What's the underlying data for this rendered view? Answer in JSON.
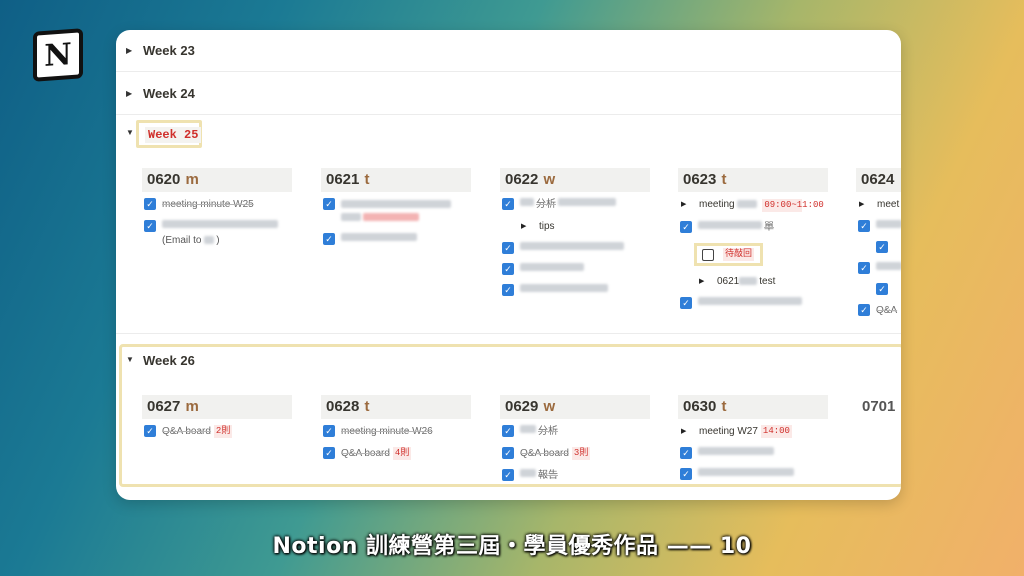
{
  "weeks": {
    "w23": "Week 23",
    "w24": "Week 24",
    "w25": "Week 25",
    "w26": "Week 26"
  },
  "week25_days": [
    {
      "date": "0620",
      "wd": "m"
    },
    {
      "date": "0621",
      "wd": "t"
    },
    {
      "date": "0622",
      "wd": "w"
    },
    {
      "date": "0623",
      "wd": "t"
    },
    {
      "date": "0624",
      "wd": ""
    }
  ],
  "week26_days": [
    {
      "date": "0627",
      "wd": "m"
    },
    {
      "date": "0628",
      "wd": "t"
    },
    {
      "date": "0629",
      "wd": "w"
    },
    {
      "date": "0630",
      "wd": "t"
    },
    {
      "date": "0701",
      "wd": ""
    }
  ],
  "items": {
    "d0620_1": "meeting minute W25",
    "d0620_note": "(Email to",
    "d0620_note_end": ")",
    "d0622_1": "分析",
    "d0622_tips": "tips",
    "d0623_meeting": "meeting",
    "d0623_time": "09:00~11:00",
    "d0623_2": "單",
    "d0623_pending": "待敲回",
    "d0623_test_prefix": "0621",
    "d0623_test": "test",
    "d0624_1": "meet",
    "d0624_qa": "Q&A",
    "d0627_1": "Q&A board",
    "d0627_1_tag": "2則",
    "d0628_1": "meeting minute W26",
    "d0628_2": "Q&A board",
    "d0628_2_tag": "4則",
    "d0629_1": "分析",
    "d0629_2": "Q&A board",
    "d0629_2_tag": "3則",
    "d0629_3": "報告",
    "d0630_1": "meeting W27",
    "d0630_1_tag": "14:00"
  },
  "caption": "Notion 訓練營第三屆・學員優秀作品 —— 10",
  "logo": {
    "icon": "notion-logo-icon",
    "letter": "N"
  },
  "colors": {
    "accent_blue": "#2f7ed8",
    "tag_red": "#d0302c",
    "highlight": "#efe2b0"
  }
}
